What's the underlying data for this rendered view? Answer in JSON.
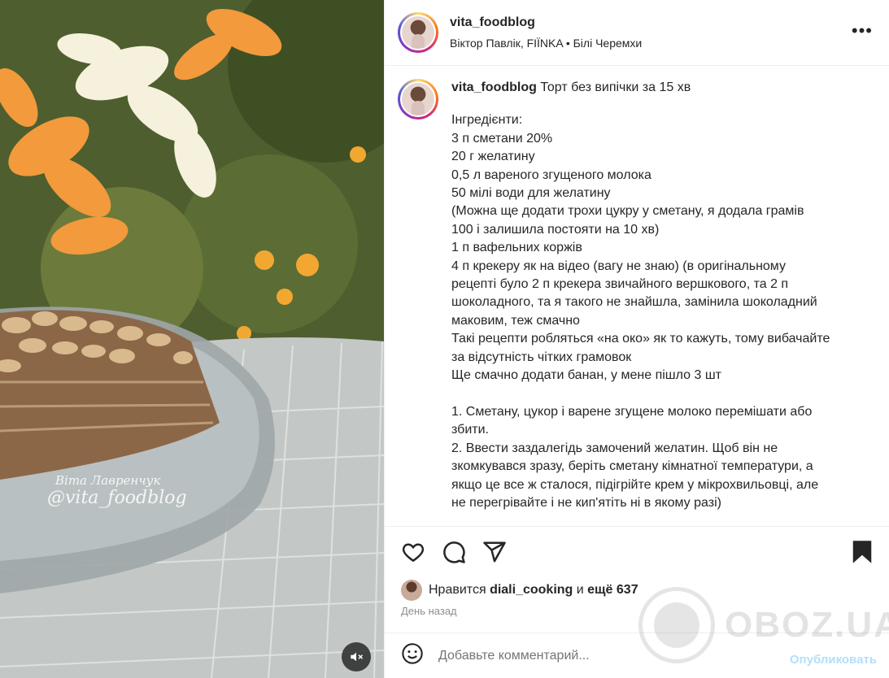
{
  "post": {
    "username": "vita_foodblog",
    "audio_line": "Віктор Павлік, FIÏNKA • Білі Черемхи",
    "more_icon": "more-horizontal-icon"
  },
  "media": {
    "watermark_name": "Віта Лавренчук",
    "watermark_handle": "@vita_foodblog",
    "mute_icon": "speaker-muted-icon"
  },
  "caption": {
    "username": "vita_foodblog",
    "title": "Торт без випічки за 15 хв",
    "lines": [
      "Інгредієнти:",
      "3 п сметани 20%",
      "20 г желатину",
      "0,5 л вареного згущеного молока",
      "50 мілі води для желатину",
      "(Можна ще додати трохи цукру у сметану, я додала грамів",
      "100 і залишила постояти на 10 хв)",
      "1 п вафельних коржів",
      "4 п крекеру як на відео (вагу не знаю) (в оригінальному",
      "рецепті було 2 п крекера звичайного вершкового, та 2 п",
      "шоколадного, та я такого не знайшла, замінила шоколадний",
      "маковим, теж смачно",
      "Такі рецепти робляться «на око» як то кажуть, тому вибачайте",
      "за відсутність чітких грамовок",
      "Ще смачно додати банан, у мене пішло 3 шт",
      "",
      "1. Сметану, цукор і варене згущене молоко перемішати або",
      "збити.",
      "2. Ввести заздалегідь замочений желатин. Щоб він не",
      "зкомкувався зразу, беріть сметану кімнатної температури, а",
      "якщо це все ж сталося, підігрійте крем у мікрохвильовці, але",
      "не перегрівайте і не кип'ятіть ні в якому разі)"
    ]
  },
  "actions": {
    "like_icon": "heart-icon",
    "comment_icon": "comment-bubble-icon",
    "share_icon": "paper-plane-icon",
    "save_icon": "bookmark-icon"
  },
  "likes": {
    "prefix": "Нравится",
    "user": "diali_cooking",
    "conj": "и",
    "rest": "ещё 637"
  },
  "timestamp": "День назад",
  "comment": {
    "placeholder": "Добавьте комментарий...",
    "publish_label": "Опубликовать",
    "emoji_icon": "smiley-icon"
  },
  "overlay_watermark": "OBOZ.UA"
}
